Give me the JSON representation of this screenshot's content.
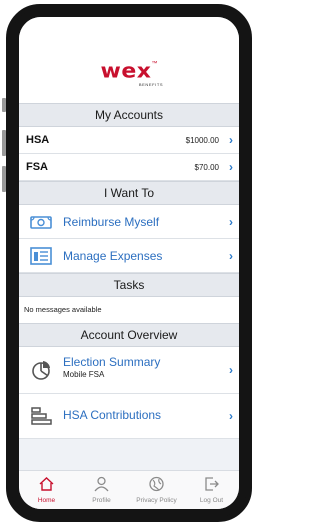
{
  "brand": {
    "logo_text": "wex",
    "logo_tm": "™",
    "logo_subtext": "BENEFITS",
    "accent_color": "#c8102e",
    "link_color": "#2c6fc0"
  },
  "my_accounts": {
    "title": "My Accounts",
    "rows": [
      {
        "name": "HSA",
        "amount": "$1000.00",
        "chevron": "›"
      },
      {
        "name": "FSA",
        "amount": "$70.00",
        "chevron": "›"
      }
    ]
  },
  "i_want_to": {
    "title": "I Want To",
    "rows": [
      {
        "label": "Reimburse Myself",
        "icon": "money-icon",
        "chevron": "›"
      },
      {
        "label": "Manage Expenses",
        "icon": "receipt-icon",
        "chevron": "›"
      }
    ]
  },
  "tasks": {
    "title": "Tasks",
    "message": "No messages available"
  },
  "account_overview": {
    "title": "Account Overview",
    "rows": [
      {
        "title": "Election Summary",
        "subtitle": "Mobile FSA",
        "icon": "pie-chart-icon",
        "chevron": "›"
      },
      {
        "title": "HSA Contributions",
        "icon": "bar-chart-icon",
        "chevron": "›"
      }
    ]
  },
  "tabbar": {
    "items": [
      {
        "label": "Home",
        "icon": "home-icon",
        "active": true
      },
      {
        "label": "Profile",
        "icon": "profile-icon",
        "active": false
      },
      {
        "label": "Privacy Policy",
        "icon": "globe-icon",
        "active": false
      },
      {
        "label": "Log Out",
        "icon": "logout-icon",
        "active": false
      }
    ]
  }
}
